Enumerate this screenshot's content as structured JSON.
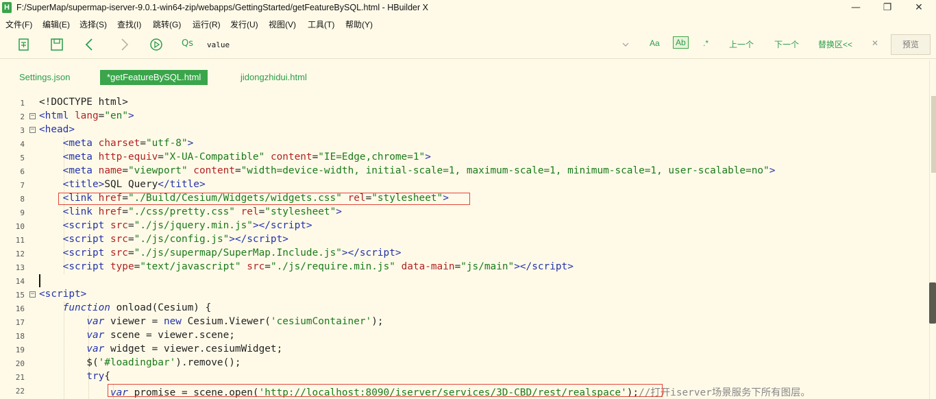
{
  "window": {
    "app_icon": "H",
    "title": "F:/SuperMap/supermap-iserver-9.0.1-win64-zip/webapps/GettingStarted/getFeatureBySQL.html - HBuilder X",
    "minimize": "—",
    "maximize": "❐",
    "close": "✕"
  },
  "menu": [
    "文件(F)",
    "编辑(E)",
    "选择(S)",
    "查找(I)",
    "跳转(G)",
    "运行(R)",
    "发行(U)",
    "视图(V)",
    "工具(T)",
    "帮助(Y)"
  ],
  "toolbar": {
    "icons": [
      "new-file-icon",
      "save-icon",
      "back-icon",
      "forward-icon",
      "run-icon"
    ],
    "search_glyph": "Qs",
    "search_value": "value",
    "match_case": "Aa",
    "whole_word": "Ab",
    "regex": ".*",
    "prev": "上一个",
    "next": "下一个",
    "replace": "替换区<<",
    "close_find": "✕",
    "preview": "预览"
  },
  "tabs": [
    {
      "label": "Settings.json",
      "active": false
    },
    {
      "label": "*getFeatureBySQL.html",
      "active": true
    },
    {
      "label": "jidongzhidui.html",
      "active": false
    }
  ],
  "editor": {
    "line_numbers": [
      "1",
      "2",
      "3",
      "4",
      "5",
      "6",
      "7",
      "8",
      "9",
      "10",
      "11",
      "12",
      "13",
      "14",
      "15",
      "16",
      "17",
      "18",
      "19",
      "20",
      "21",
      "22"
    ]
  },
  "colors": {
    "accent": "#3aa54a",
    "background": "#fffae8",
    "highlight_box": "#e0453a"
  }
}
